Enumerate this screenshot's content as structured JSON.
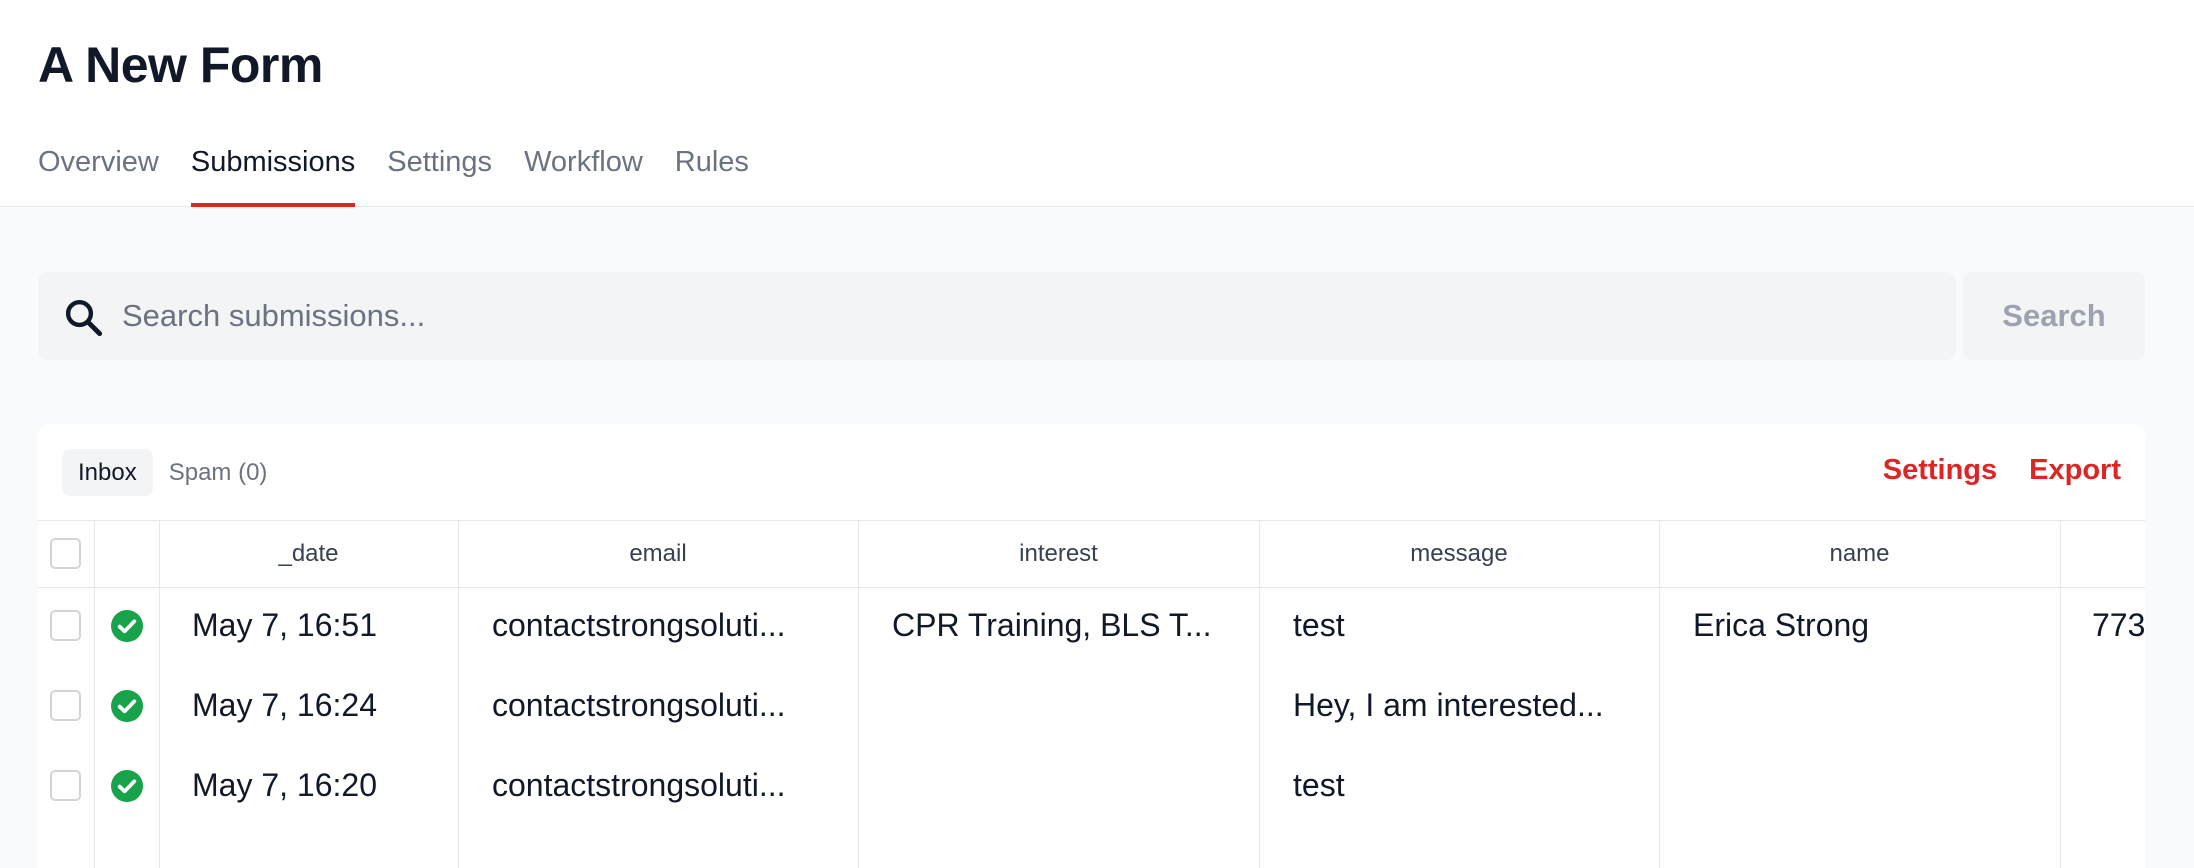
{
  "title": "A New Form",
  "tabs": [
    "Overview",
    "Submissions",
    "Settings",
    "Workflow",
    "Rules"
  ],
  "search": {
    "placeholder": "Search submissions...",
    "button": "Search"
  },
  "panel": {
    "tabs": [
      "Inbox",
      "Spam (0)"
    ],
    "actions": [
      "Settings",
      "Export"
    ]
  },
  "table": {
    "columns": [
      "_date",
      "email",
      "interest",
      "message",
      "name"
    ],
    "rows": [
      {
        "date": "May 7, 16:51",
        "email": "contactstrongsoluti...",
        "interest": "CPR Training, BLS T...",
        "message": "test",
        "name": "Erica Strong",
        "extra": "773"
      },
      {
        "date": "May 7, 16:24",
        "email": "contactstrongsoluti...",
        "interest": "",
        "message": "Hey, I am interested...",
        "name": "",
        "extra": ""
      },
      {
        "date": "May 7, 16:20",
        "email": "contactstrongsoluti...",
        "interest": "",
        "message": "test",
        "name": "",
        "extra": ""
      }
    ]
  },
  "colors": {
    "accent": "#dc2626",
    "success": "#16a34a"
  }
}
